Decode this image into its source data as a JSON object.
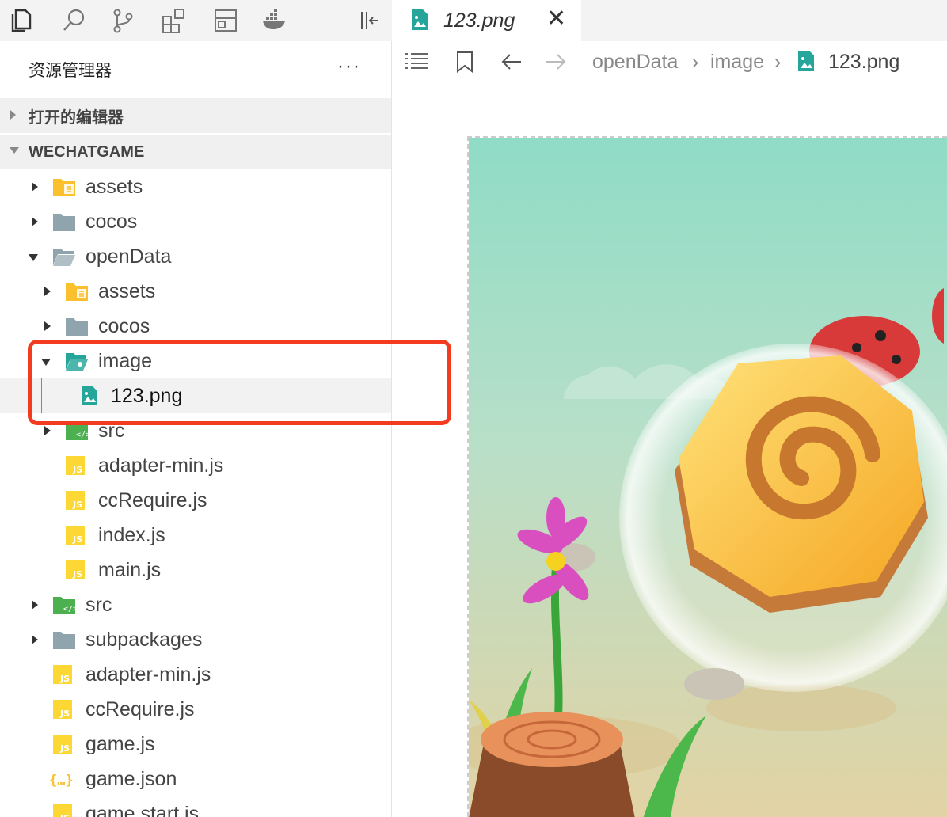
{
  "activity_bar": {
    "icons": [
      "files-icon",
      "search-icon",
      "source-control-icon",
      "extensions-icon",
      "layout-icon",
      "docker-icon",
      "collapse-panel-icon"
    ]
  },
  "sidebar": {
    "title": "资源管理器",
    "more": "···",
    "sections": {
      "open_editors": "打开的编辑器",
      "project": "WECHATGAME"
    },
    "tree": [
      {
        "label": "assets",
        "icon": "folder-assets-icon"
      },
      {
        "label": "cocos",
        "icon": "folder-icon"
      },
      {
        "label": "openData",
        "icon": "folder-open-icon"
      },
      {
        "label": "assets",
        "icon": "folder-assets-icon"
      },
      {
        "label": "cocos",
        "icon": "folder-icon"
      },
      {
        "label": "image",
        "icon": "folder-image-icon"
      },
      {
        "label": "123.png",
        "icon": "image-file-icon"
      },
      {
        "label": "src",
        "icon": "folder-src-icon"
      },
      {
        "label": "adapter-min.js",
        "icon": "js-file-icon"
      },
      {
        "label": "ccRequire.js",
        "icon": "js-file-icon"
      },
      {
        "label": "index.js",
        "icon": "js-file-icon"
      },
      {
        "label": "main.js",
        "icon": "js-file-icon"
      },
      {
        "label": "src",
        "icon": "folder-src-icon"
      },
      {
        "label": "subpackages",
        "icon": "folder-icon"
      },
      {
        "label": "adapter-min.js",
        "icon": "js-file-icon"
      },
      {
        "label": "ccRequire.js",
        "icon": "js-file-icon"
      },
      {
        "label": "game.js",
        "icon": "js-file-icon"
      },
      {
        "label": "game.json",
        "icon": "json-file-icon"
      },
      {
        "label": "game.start.js",
        "icon": "js-file-icon"
      }
    ],
    "selected": "123.png"
  },
  "editor": {
    "tab": {
      "label": "123.png",
      "close": "✕"
    },
    "breadcrumb": [
      "openData",
      "image",
      "123.png"
    ],
    "preview": {
      "description_icon": "image-preview"
    }
  },
  "colors": {
    "highlight_border": "#f23b1f",
    "folder_gray": "#90a4ae",
    "folder_yellow": "#fbc02d",
    "src_green": "#4caf50",
    "image_teal": "#26a69a",
    "js_yellow": "#fdd835"
  }
}
